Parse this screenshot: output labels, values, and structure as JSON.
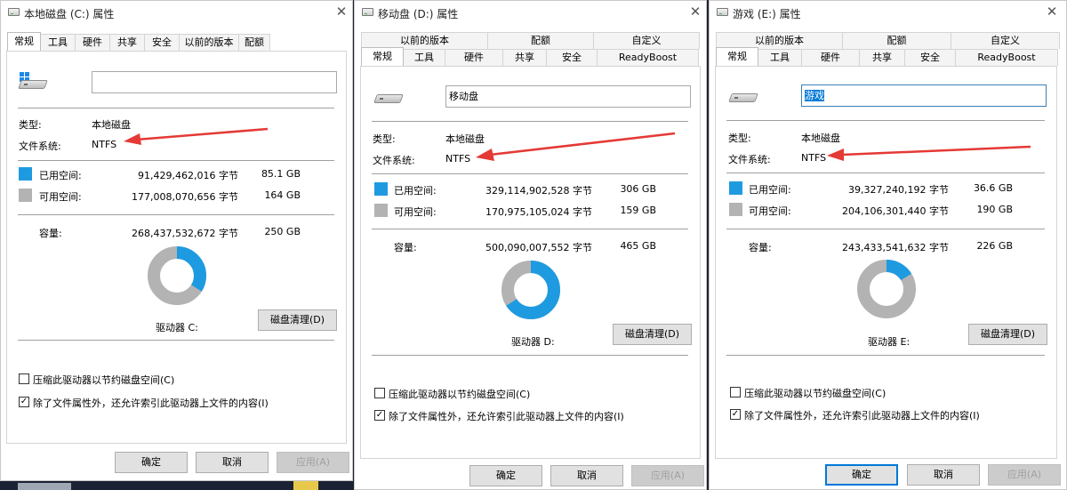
{
  "windows": [
    {
      "title": "本地磁盘 (C:) 属性",
      "tabs_row1": [],
      "tabs_row2": [
        "常规",
        "工具",
        "硬件",
        "共享",
        "安全",
        "以前的版本",
        "配额"
      ],
      "name_value": "",
      "type_label": "类型:",
      "type_value": "本地磁盘",
      "fs_label": "文件系统:",
      "fs_value": "NTFS",
      "used_label": "已用空间:",
      "used_bytes": "91,429,462,016 字节",
      "used_gb": "85.1 GB",
      "free_label": "可用空间:",
      "free_bytes": "177,008,070,656 字节",
      "free_gb": "164 GB",
      "cap_label": "容量:",
      "cap_bytes": "268,437,532,672 字节",
      "cap_gb": "250 GB",
      "used_fraction": 0.34,
      "drive_label": "驱动器 C:",
      "cleanup_button": "磁盘清理(D)",
      "compress_label": "压缩此驱动器以节约磁盘空间(C)",
      "compress_checked": false,
      "index_label": "除了文件属性外，还允许索引此驱动器上文件的内容(I)",
      "index_checked": true,
      "ok": "确定",
      "cancel": "取消",
      "apply": "应用(A)"
    },
    {
      "title": "移动盘 (D:) 属性",
      "tabs_row1": [
        "以前的版本",
        "配额",
        "自定义"
      ],
      "tabs_row2": [
        "常规",
        "工具",
        "硬件",
        "共享",
        "安全",
        "ReadyBoost"
      ],
      "name_value": "移动盘",
      "type_label": "类型:",
      "type_value": "本地磁盘",
      "fs_label": "文件系统:",
      "fs_value": "NTFS",
      "used_label": "已用空间:",
      "used_bytes": "329,114,902,528 字节",
      "used_gb": "306 GB",
      "free_label": "可用空间:",
      "free_bytes": "170,975,105,024 字节",
      "free_gb": "159 GB",
      "cap_label": "容量:",
      "cap_bytes": "500,090,007,552 字节",
      "cap_gb": "465 GB",
      "used_fraction": 0.658,
      "drive_label": "驱动器 D:",
      "cleanup_button": "磁盘清理(D)",
      "compress_label": "压缩此驱动器以节约磁盘空间(C)",
      "compress_checked": false,
      "index_label": "除了文件属性外，还允许索引此驱动器上文件的内容(I)",
      "index_checked": true,
      "ok": "确定",
      "cancel": "取消",
      "apply": "应用(A)"
    },
    {
      "title": "游戏 (E:) 属性",
      "tabs_row1": [
        "以前的版本",
        "配额",
        "自定义"
      ],
      "tabs_row2": [
        "常规",
        "工具",
        "硬件",
        "共享",
        "安全",
        "ReadyBoost"
      ],
      "name_value": "游戏",
      "type_label": "类型:",
      "type_value": "本地磁盘",
      "fs_label": "文件系统:",
      "fs_value": "NTFS",
      "used_label": "已用空间:",
      "used_bytes": "39,327,240,192 字节",
      "used_gb": "36.6 GB",
      "free_label": "可用空间:",
      "free_bytes": "204,106,301,440 字节",
      "free_gb": "190 GB",
      "cap_label": "容量:",
      "cap_bytes": "243,433,541,632 字节",
      "cap_gb": "226 GB",
      "used_fraction": 0.162,
      "drive_label": "驱动器 E:",
      "cleanup_button": "磁盘清理(D)",
      "compress_label": "压缩此驱动器以节约磁盘空间(C)",
      "compress_checked": false,
      "index_label": "除了文件属性外，还允许索引此驱动器上文件的内容(I)",
      "index_checked": true,
      "ok": "确定",
      "cancel": "取消",
      "apply": "应用(A)"
    }
  ],
  "colors": {
    "used": "#1e9be0",
    "free": "#b3b3b3",
    "arrow": "#e53935",
    "accent": "#0078d7"
  },
  "icons": {
    "title": "drive-icon",
    "close": "close-icon",
    "windows": "windows-logo-icon"
  }
}
